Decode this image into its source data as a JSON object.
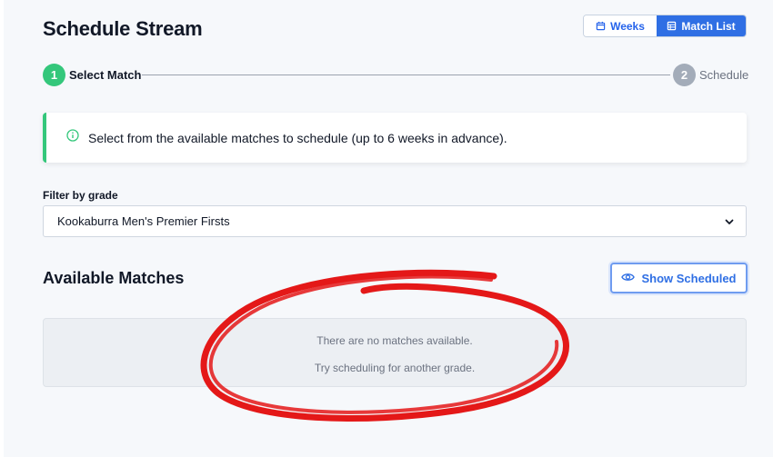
{
  "page": {
    "title": "Schedule Stream"
  },
  "view_toggle": {
    "weeks_label": "Weeks",
    "list_label": "Match List",
    "active": "Match List"
  },
  "stepper": {
    "steps": [
      {
        "number": "1",
        "label": "Select Match",
        "state": "active"
      },
      {
        "number": "2",
        "label": "Schedule",
        "state": "inactive"
      }
    ]
  },
  "info": {
    "text": "Select from the available matches to schedule (up to 6 weeks in advance)."
  },
  "filter": {
    "label": "Filter by grade",
    "selected": "Kookaburra Men's Premier Firsts"
  },
  "matches": {
    "title": "Available Matches",
    "show_scheduled_label": "Show Scheduled",
    "empty_line1": "There are no matches available.",
    "empty_line2": "Try scheduling for another grade."
  },
  "colors": {
    "accent_blue": "#2f6fe4",
    "success_green": "#34c77b",
    "annotation_red": "#e41818"
  },
  "icons": [
    "calendar-icon",
    "table-icon",
    "info-circle-icon",
    "chevron-down-icon",
    "eye-icon"
  ]
}
